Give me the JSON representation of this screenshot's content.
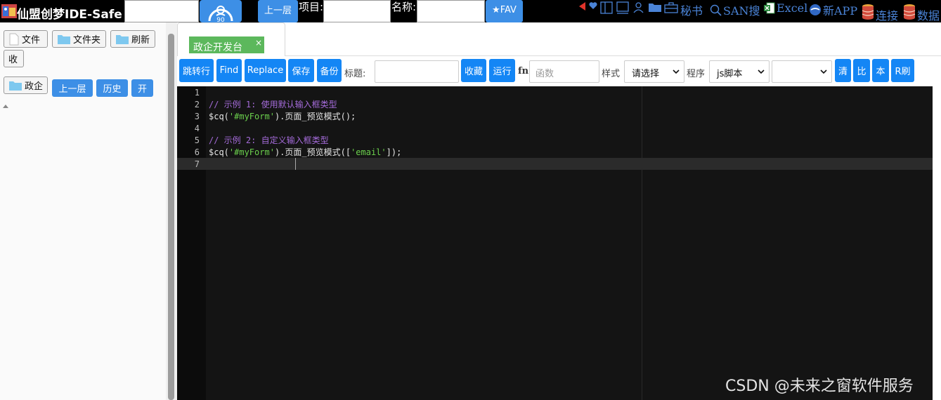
{
  "app": {
    "title": "仙盟创梦IDE-Safe"
  },
  "topbar": {
    "gauge_label": "90",
    "up_button": "上一层",
    "project_label": "项目:",
    "name_label": "名称:",
    "fav_button": "★FAV",
    "links": [
      {
        "icon": "back-icon",
        "label": ""
      },
      {
        "icon": "heart-icon",
        "label": ""
      },
      {
        "icon": "panel-icon",
        "label": ""
      },
      {
        "icon": "monitor-icon",
        "label": ""
      },
      {
        "icon": "user-icon",
        "label": ""
      },
      {
        "icon": "folder-icon",
        "label": ""
      },
      {
        "icon": "briefcase-icon",
        "label": ""
      },
      {
        "icon": "secretary",
        "label": "秘书"
      },
      {
        "icon": "search-icon",
        "label": "SAN搜"
      },
      {
        "icon": "excel-icon",
        "label": "Excel"
      },
      {
        "icon": "app-icon",
        "label": "新APP"
      },
      {
        "icon": "database-icon",
        "label": "连接"
      },
      {
        "icon": "database-icon",
        "label": "数据"
      }
    ]
  },
  "sidebar": {
    "file_button": "文件",
    "folder_button": "文件夹",
    "refresh_button": "刷新",
    "collapse_button": "收",
    "current_folder": "政企",
    "up_button": "上一层",
    "history_button": "历史",
    "open_button": "开"
  },
  "tabs": [
    {
      "label": "政企开发台",
      "close": "×",
      "active": true
    }
  ],
  "toolbar": {
    "jump_line": "跳转行",
    "find": "Find",
    "replace": "Replace",
    "save": "保存",
    "backup": "备份",
    "title_label": "标题:",
    "title_value": "",
    "favorite": "收藏",
    "run": "运行",
    "fn_label": "fn",
    "function_placeholder": "函数",
    "style_label": "样式",
    "style_value": "请选择",
    "program_label": "程序",
    "program_value": "js脚本",
    "extra_select_value": "",
    "clear": "清",
    "compare": "比",
    "local": "本",
    "refresh_r": "R刷"
  },
  "editor": {
    "line_numbers": [
      "1",
      "2",
      "3",
      "4",
      "5",
      "6",
      "7"
    ],
    "active_line": "7",
    "lines": [
      "",
      "// 示例 1: 使用默认输入框类型",
      "$cq('#myForm').页面_预览模式();",
      "",
      "// 示例 2: 自定义输入框类型",
      "$cq('#myForm').页面_预览模式(['email']);",
      ""
    ],
    "line3": {
      "a": "$cq(",
      "b": "'#myForm'",
      "c": ").页面_预览模式();"
    },
    "line6": {
      "a": "$cq(",
      "b": "'#myForm'",
      "c": ").页面_预览模式([",
      "d": "'email'",
      "e": "]);"
    }
  },
  "watermark": "CSDN @未来之窗软件服务",
  "colors": {
    "accent": "#1486f5",
    "tab_active": "#5cb85c",
    "editor_bg": "#141414",
    "comment": "#a46bd9",
    "string": "#6bd14d"
  }
}
